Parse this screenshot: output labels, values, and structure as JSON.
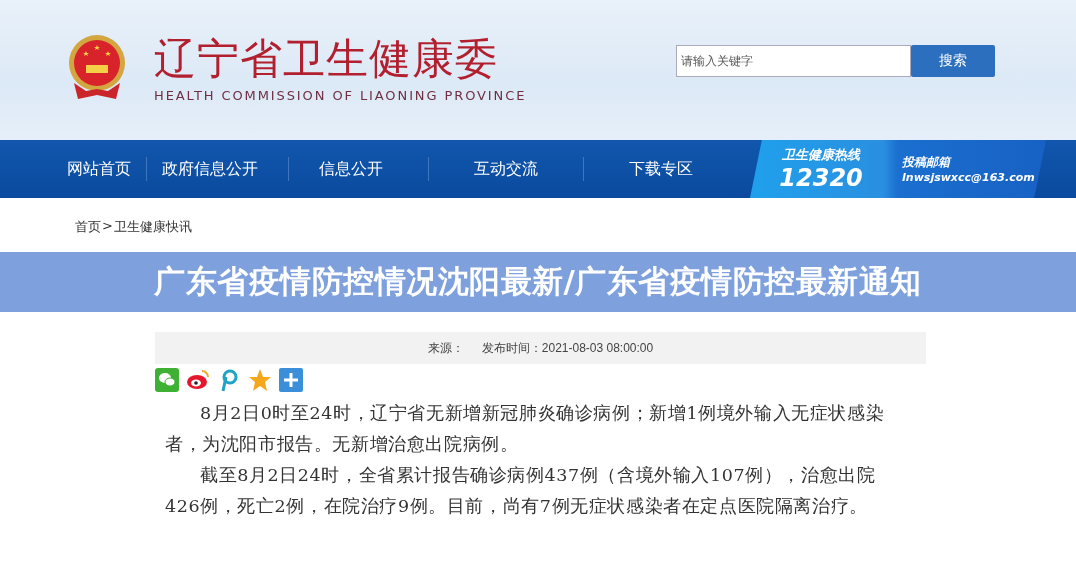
{
  "header": {
    "title": "辽宁省卫生健康委",
    "subtitle": "HEALTH COMMISSION OF LIAONING PROVINCE",
    "search": {
      "placeholder": "请输入关键字"
    },
    "search_button": "搜索"
  },
  "nav": {
    "items": [
      {
        "label": "网站首页"
      },
      {
        "label": "政府信息公开"
      },
      {
        "label": "信息公开"
      },
      {
        "label": "互动交流"
      },
      {
        "label": "下载专区"
      }
    ],
    "hotline": {
      "label": "卫生健康热线",
      "number": "12320"
    },
    "mailbox": {
      "label": "投稿邮箱",
      "address": "lnwsjswxcc@163.com"
    }
  },
  "breadcrumb": {
    "items": [
      "首页",
      "卫生健康快讯"
    ],
    "separator": ">"
  },
  "banner": {
    "title": "广东省疫情防控情况沈阳最新/广东省疫情防控最新通知"
  },
  "article": {
    "source_label": "来源：",
    "published": "发布时间：2021-08-03 08:00:00",
    "paragraphs": [
      "8月2日0时至24时，辽宁省无新增新冠肺炎确诊病例；新增1例境外输入无症状感染者，为沈阳市报告。无新增治愈出院病例。",
      "截至8月2日24时，全省累计报告确诊病例437例（含境外输入107例），治愈出院426例，死亡2例，在院治疗9例。目前，尚有7例无症状感染者在定点医院隔离治疗。"
    ]
  }
}
